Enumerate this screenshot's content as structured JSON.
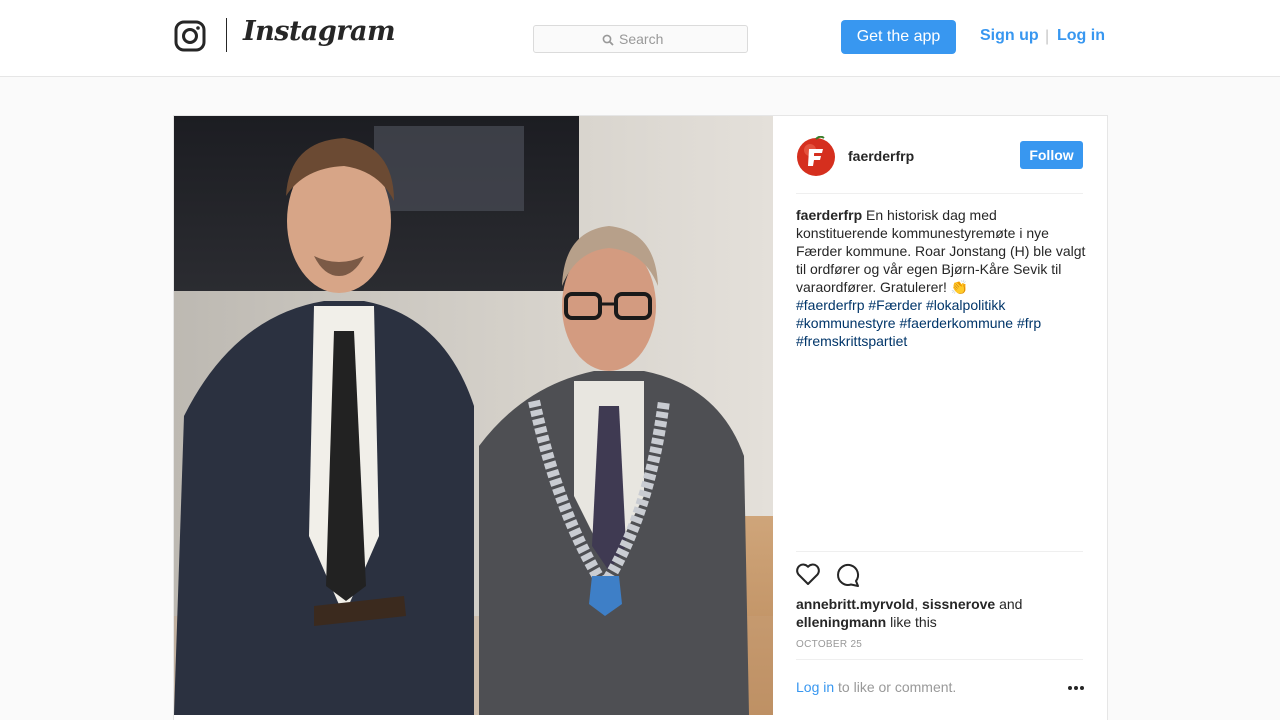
{
  "header": {
    "wordmark": "Instagram",
    "search_placeholder": "Search",
    "get_app_label": "Get the app",
    "signup_label": "Sign up",
    "separator": "|",
    "login_label": "Log in"
  },
  "post": {
    "username": "faerderfrp",
    "follow_label": "Follow",
    "caption_user": "faerderfrp",
    "caption_text": " En historisk dag med konstituerende kommunestyremøte i nye Færder kommune. Roar Jonstang (H) ble valgt til ordfører og vår egen Bjørn-Kåre Sevik til varaordfører. Gratulerer! 👏",
    "hashtags": [
      "#faerderfrp",
      "#Færder",
      "#lokalpolitikk",
      "#kommunestyre",
      "#faerderkommune",
      "#frp",
      "#fremskrittspartiet"
    ],
    "likes": {
      "user1": "annebritt.myrvold",
      "comma": ", ",
      "user2": "sissnerove",
      "and": " and",
      "user3": "elleningmann",
      "suffix": " like this"
    },
    "date": "OCTOBER 25",
    "login_link": "Log in",
    "login_suffix": " to like or comment."
  },
  "icons": {
    "logo": "instagram-glyph-icon",
    "search": "search-icon",
    "like": "heart-icon",
    "comment": "comment-icon",
    "more": "more-options-icon"
  },
  "colors": {
    "accent": "#3897f0",
    "hashtag": "#003569",
    "muted": "#999999",
    "background": "#fafafa"
  }
}
